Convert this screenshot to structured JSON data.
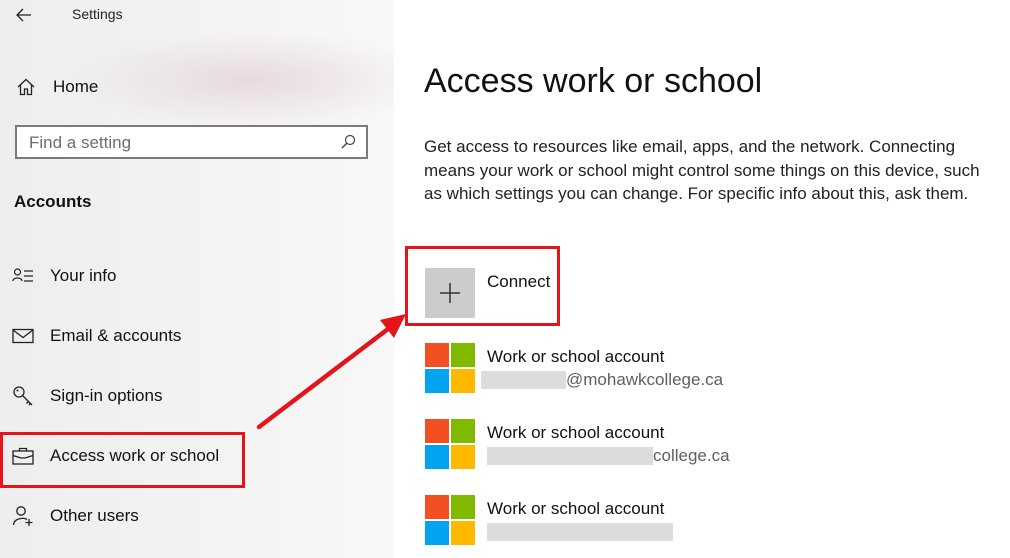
{
  "app": {
    "title": "Settings"
  },
  "sidebar": {
    "home_label": "Home",
    "search_placeholder": "Find a setting",
    "section_title": "Accounts",
    "items": [
      {
        "label": "Your info",
        "icon": "person-lines-icon"
      },
      {
        "label": "Email & accounts",
        "icon": "envelope-icon"
      },
      {
        "label": "Sign-in options",
        "icon": "key-icon"
      },
      {
        "label": "Access work or school",
        "icon": "briefcase-icon",
        "selected": true
      },
      {
        "label": "Other users",
        "icon": "person-add-icon"
      }
    ]
  },
  "main": {
    "title": "Access work or school",
    "description": "Get access to resources like email, apps, and the network. Connecting means your work or school might control some things on this device, such as which settings you can change. For specific info about this, ask them.",
    "connect_label": "Connect",
    "accounts": [
      {
        "title": "Work or school account",
        "email_visible": "@mohawkcollege.ca"
      },
      {
        "title": "Work or school account",
        "email_visible": "college.ca"
      },
      {
        "title": "Work or school account",
        "email_visible": ""
      }
    ]
  },
  "colors": {
    "annotation_red": "#e3141a",
    "ms_red": "#f25022",
    "ms_green": "#7fba00",
    "ms_blue": "#00a4ef",
    "ms_yellow": "#ffb900"
  }
}
